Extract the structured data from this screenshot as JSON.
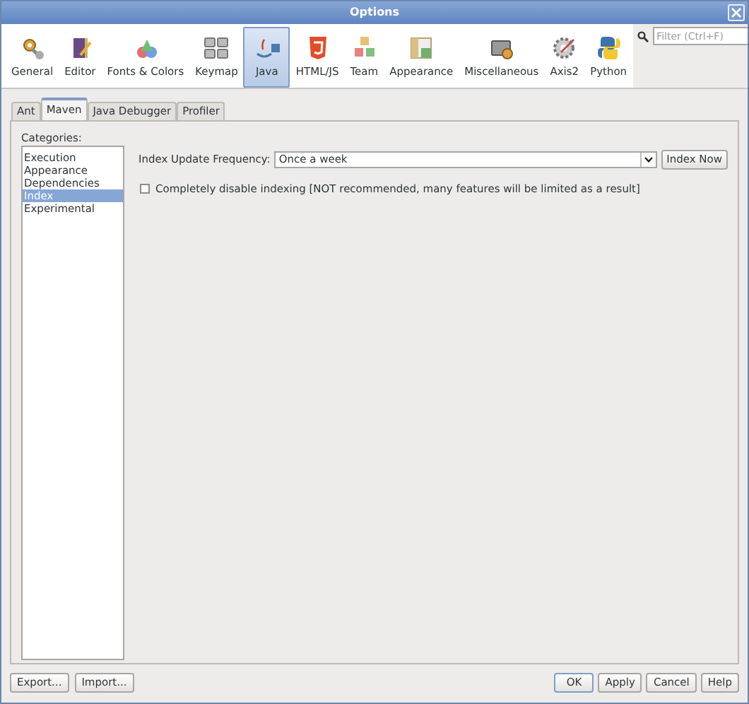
{
  "window": {
    "title": "Options"
  },
  "categories": [
    {
      "label": "General",
      "selected": false
    },
    {
      "label": "Editor",
      "selected": false
    },
    {
      "label": "Fonts & Colors",
      "selected": false
    },
    {
      "label": "Keymap",
      "selected": false
    },
    {
      "label": "Java",
      "selected": true
    },
    {
      "label": "HTML/JS",
      "selected": false
    },
    {
      "label": "Team",
      "selected": false
    },
    {
      "label": "Appearance",
      "selected": false
    },
    {
      "label": "Miscellaneous",
      "selected": false
    },
    {
      "label": "Axis2",
      "selected": false
    },
    {
      "label": "Python",
      "selected": false
    }
  ],
  "filter": {
    "placeholder": "Filter (Ctrl+F)"
  },
  "tabs": [
    {
      "label": "Ant",
      "selected": false
    },
    {
      "label": "Maven",
      "selected": true
    },
    {
      "label": "Java Debugger",
      "selected": false
    },
    {
      "label": "Profiler",
      "selected": false
    }
  ],
  "categories_label": "Categories:",
  "category_list": [
    {
      "label": "Execution",
      "selected": false
    },
    {
      "label": "Appearance",
      "selected": false
    },
    {
      "label": "Dependencies",
      "selected": false
    },
    {
      "label": "Index",
      "selected": true
    },
    {
      "label": "Experimental",
      "selected": false
    }
  ],
  "frequency": {
    "label": "Index Update Frequency:",
    "value": "Once a week",
    "button": "Index Now"
  },
  "disable_indexing": {
    "label": "Completely disable indexing [NOT recommended, many features will be limited as a result]",
    "checked": false
  },
  "footer_left": [
    "Export...",
    "Import..."
  ],
  "footer_right": [
    {
      "label": "OK",
      "default": true
    },
    {
      "label": "Apply",
      "default": false
    },
    {
      "label": "Cancel",
      "default": false
    },
    {
      "label": "Help",
      "default": false
    }
  ]
}
